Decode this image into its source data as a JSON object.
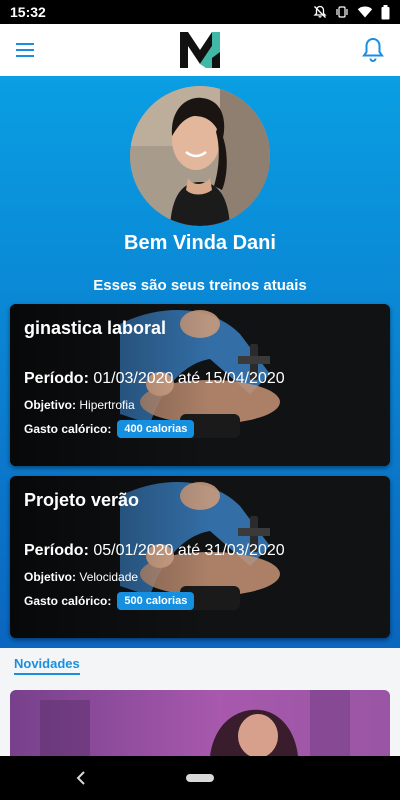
{
  "status_bar": {
    "time": "15:32",
    "icons": [
      "bell-off-icon",
      "vibrate-icon",
      "wifi-icon",
      "battery-icon"
    ]
  },
  "app_bar": {
    "menu_icon": "hamburger-menu-icon",
    "logo": "m-logo",
    "notification_icon": "bell-icon"
  },
  "profile": {
    "greeting": "Bem Vinda Dani"
  },
  "workouts": {
    "subtitle": "Esses são seus treinos atuais",
    "items": [
      {
        "title": "ginastica laboral",
        "period_label": "Período:",
        "period": "01/03/2020 até 15/04/2020",
        "goal_label": "Objetivo:",
        "goal": "Hipertrofia",
        "kcal_label": "Gasto calórico:",
        "kcal": "400 calorias"
      },
      {
        "title": "Projeto verão",
        "period_label": "Período:",
        "period": "05/01/2020 até 31/03/2020",
        "goal_label": "Objetivo:",
        "goal": "Velocidade",
        "kcal_label": "Gasto calórico:",
        "kcal": "500 calorias"
      }
    ]
  },
  "news": {
    "label": "Novidades"
  },
  "colors": {
    "accent": "#0b8fe0",
    "pill": "#1590e0",
    "logo_teal": "#3fb8a8"
  }
}
